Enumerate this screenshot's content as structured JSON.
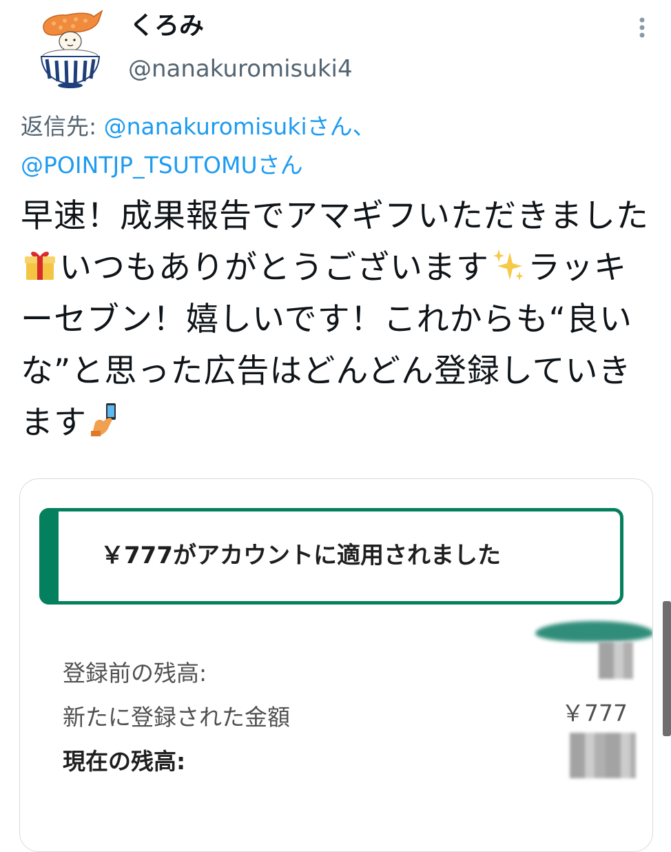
{
  "tweet": {
    "display_name": "くろみ",
    "handle": "@nanakuromisuki4",
    "reply_prefix": "返信先: ",
    "reply_mention_1": "@nanakuromisukiさん、",
    "reply_mention_2": "@POINTJP_TSUTOMUさん",
    "text_part_1": "早速！成果報告でアマギフいただきました",
    "emoji_1": "wrapped-gift-icon",
    "text_part_2": "いつもありがとうございます",
    "emoji_2": "sparkles-icon",
    "text_part_3": "ラッキーセブン！嬉しいです！これからも“良いな”と思った広告はどんどん登録していきます",
    "emoji_3": "selfie-hand-icon"
  },
  "media": {
    "banner_text": "￥777がアカウントに適用されました",
    "rows": [
      {
        "label": "登録前の残高:",
        "value": ""
      },
      {
        "label": "新たに登録された金額",
        "value": "￥777"
      },
      {
        "label": "現在の残高:",
        "value": ""
      }
    ],
    "accent_color": "#05805e"
  },
  "colors": {
    "link": "#1d9bf0",
    "secondary_text": "#536471",
    "primary_text": "#0f1419"
  }
}
